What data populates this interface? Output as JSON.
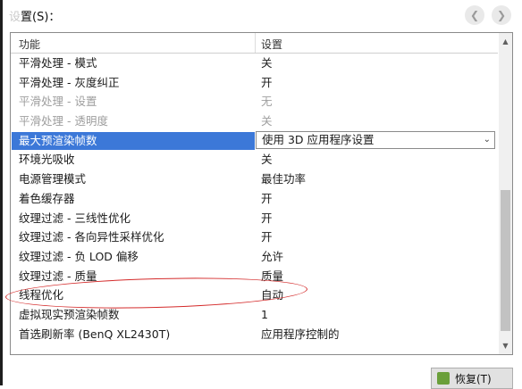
{
  "header": {
    "label_visible": "置(S)："
  },
  "controls": {
    "back_glyph": "❮",
    "forward_glyph": "❯"
  },
  "table": {
    "columns": [
      "功能",
      "设置"
    ],
    "rows": [
      {
        "name": "平滑处理 - 模式",
        "value": "关",
        "state": "normal"
      },
      {
        "name": "平滑处理 - 灰度纠正",
        "value": "开",
        "state": "normal"
      },
      {
        "name": "平滑处理 - 设置",
        "value": "无",
        "state": "disabled"
      },
      {
        "name": "平滑处理 - 透明度",
        "value": "关",
        "state": "disabled"
      },
      {
        "name": "最大预渲染帧数",
        "value": "使用 3D 应用程序设置",
        "state": "selected"
      },
      {
        "name": "环境光吸收",
        "value": "关",
        "state": "normal"
      },
      {
        "name": "电源管理模式",
        "value": "最佳功率",
        "state": "normal"
      },
      {
        "name": "着色缓存器",
        "value": "开",
        "state": "normal"
      },
      {
        "name": "纹理过滤 - 三线性优化",
        "value": "开",
        "state": "normal"
      },
      {
        "name": "纹理过滤 - 各向异性采样优化",
        "value": "开",
        "state": "normal"
      },
      {
        "name": "纹理过滤 - 负 LOD 偏移",
        "value": "允许",
        "state": "normal"
      },
      {
        "name": "纹理过滤 - 质量",
        "value": "质量",
        "state": "normal"
      },
      {
        "name": "线程优化",
        "value": "自动",
        "state": "normal"
      },
      {
        "name": "虚拟现实预渲染帧数",
        "value": "1",
        "state": "normal"
      },
      {
        "name": "首选刷新率 (BenQ XL2430T)",
        "value": "应用程序控制的",
        "state": "normal"
      }
    ]
  },
  "buttons": {
    "restore_label": "恢复(T)"
  },
  "colors": {
    "selection": "#3c78d8",
    "annotation": "#d42a2a"
  }
}
